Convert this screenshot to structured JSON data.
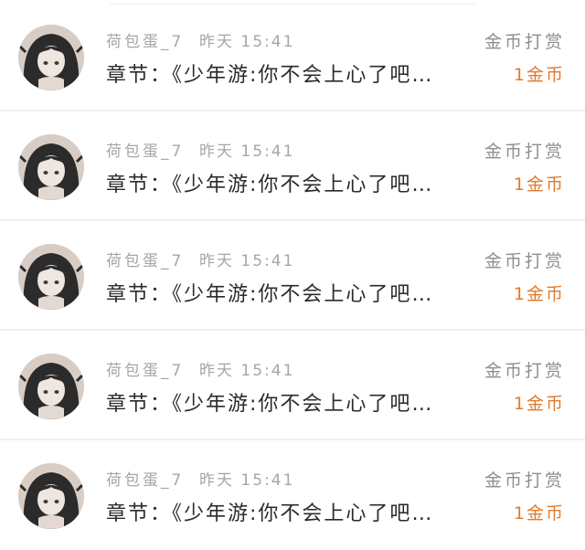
{
  "colors": {
    "accent_orange": "#e07a2c",
    "meta_gray": "#a6a6a6",
    "text_dark": "#2a2a2a"
  },
  "records": [
    {
      "username": "荷包蛋_7",
      "time": "昨天 15:41",
      "content": "章节：《少年游:你不会上心了吧…",
      "tip_label": "金币打赏",
      "amount": "1金币",
      "avatar_icon": "anime-girl-avatar"
    },
    {
      "username": "荷包蛋_7",
      "time": "昨天 15:41",
      "content": "章节：《少年游:你不会上心了吧…",
      "tip_label": "金币打赏",
      "amount": "1金币",
      "avatar_icon": "anime-girl-avatar"
    },
    {
      "username": "荷包蛋_7",
      "time": "昨天 15:41",
      "content": "章节：《少年游:你不会上心了吧…",
      "tip_label": "金币打赏",
      "amount": "1金币",
      "avatar_icon": "anime-girl-avatar"
    },
    {
      "username": "荷包蛋_7",
      "time": "昨天 15:41",
      "content": "章节：《少年游:你不会上心了吧…",
      "tip_label": "金币打赏",
      "amount": "1金币",
      "avatar_icon": "anime-girl-avatar"
    },
    {
      "username": "荷包蛋_7",
      "time": "昨天 15:41",
      "content": "章节：《少年游:你不会上心了吧…",
      "tip_label": "金币打赏",
      "amount": "1金币",
      "avatar_icon": "anime-girl-avatar"
    }
  ]
}
